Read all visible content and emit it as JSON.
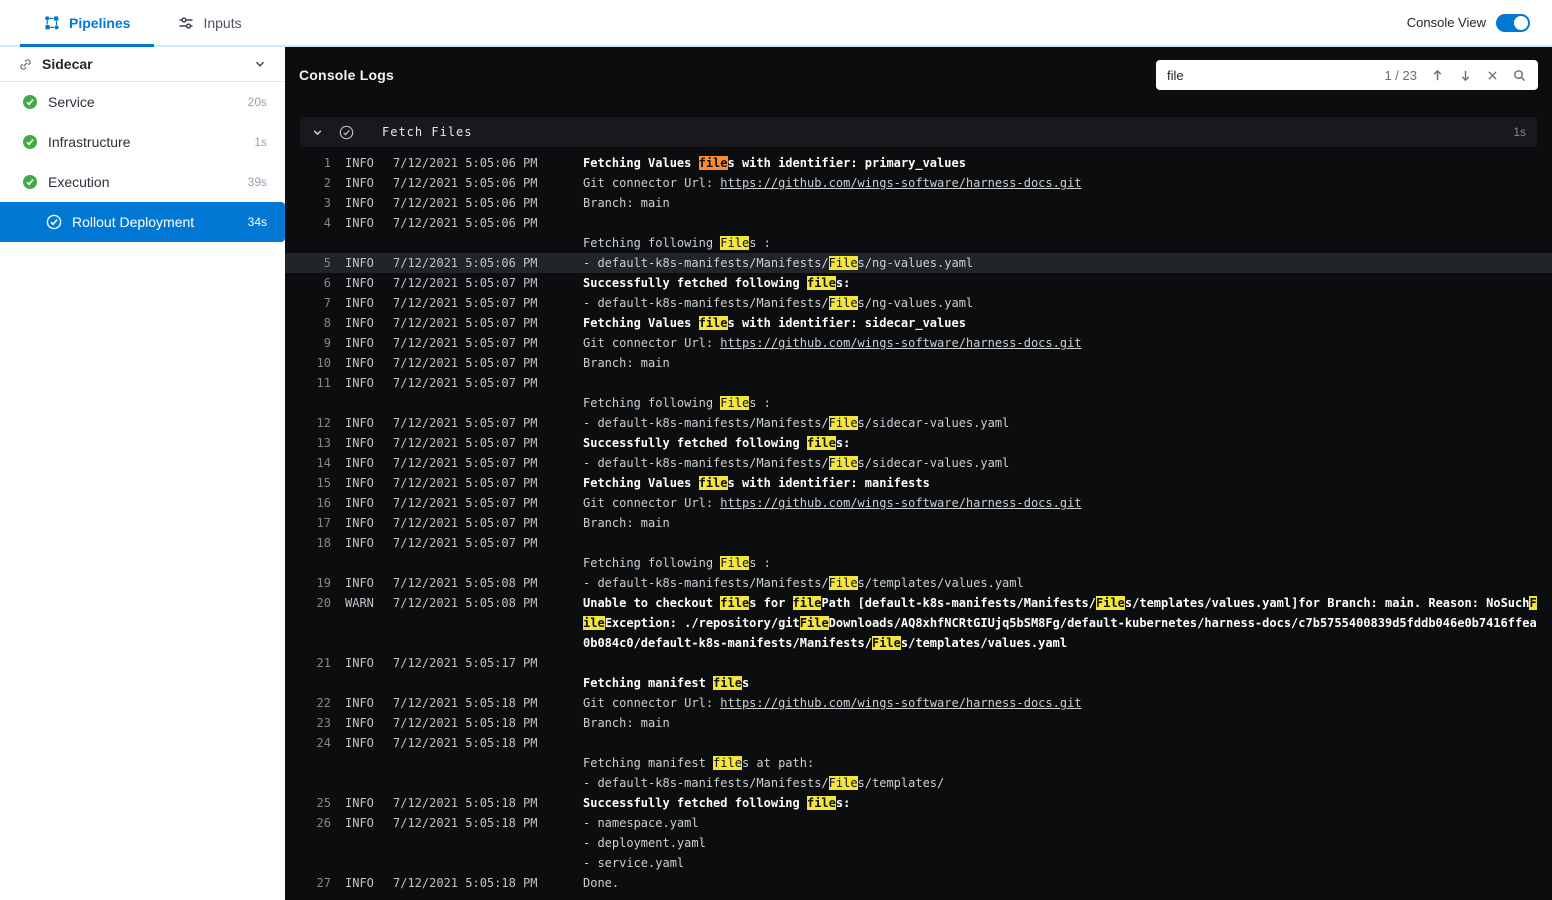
{
  "colors": {
    "accent_blue": "#0278d5",
    "success_green": "#42ab45",
    "highlight_match": "#f4e53c",
    "highlight_current_match": "#ff8c33",
    "console_bg": "#0b0d0e"
  },
  "icons": {
    "pipeline-icon": "flow-nodes",
    "tune-icon": "sliders",
    "link-icon": "chain-link",
    "chevron-down-icon": "v-chevron",
    "status-success-icon": "check-in-circle",
    "arrow-up-icon": "up-arrow",
    "arrow-down-icon": "down-arrow",
    "close-icon": "x-cross",
    "search-icon": "magnifier"
  },
  "topbar": {
    "tabs": [
      {
        "label": "Pipelines",
        "active": true
      },
      {
        "label": "Inputs",
        "active": false
      }
    ],
    "console_view_label": "Console View",
    "console_view_on": true
  },
  "sidebar": {
    "group": {
      "label": "Sidecar"
    },
    "items": [
      {
        "label": "Service",
        "duration": "20s",
        "status": "success",
        "indent": 0,
        "selected": false
      },
      {
        "label": "Infrastructure",
        "duration": "1s",
        "status": "success",
        "indent": 0,
        "selected": false
      },
      {
        "label": "Execution",
        "duration": "39s",
        "status": "success",
        "indent": 0,
        "selected": false
      },
      {
        "label": "Rollout Deployment",
        "duration": "34s",
        "status": "success",
        "indent": 1,
        "selected": true
      }
    ]
  },
  "console": {
    "title": "Console Logs",
    "search": {
      "value": "file",
      "match_count": "1 / 23"
    },
    "section": {
      "title": "Fetch Files",
      "duration": "1s",
      "status": "success"
    }
  },
  "logs": [
    {
      "num": 1,
      "level": "INFO",
      "time": "7/12/2021 5:05:06 PM",
      "bold": true,
      "lines": [
        [
          "Fetching Values ",
          {
            "t": "file",
            "h": "o"
          },
          "s with identifier: primary_values"
        ]
      ]
    },
    {
      "num": 2,
      "level": "INFO",
      "time": "7/12/2021 5:05:06 PM",
      "lines": [
        [
          "Git connector Url: ",
          {
            "t": "https://github.com/wings-software/harness-docs.git",
            "link": true
          }
        ]
      ]
    },
    {
      "num": 3,
      "level": "INFO",
      "time": "7/12/2021 5:05:06 PM",
      "lines": [
        [
          "Branch: main"
        ]
      ]
    },
    {
      "num": 4,
      "level": "INFO",
      "time": "7/12/2021 5:05:06 PM",
      "lines": [
        [],
        [
          "Fetching following ",
          {
            "t": "File",
            "h": "y"
          },
          "s :"
        ]
      ]
    },
    {
      "num": 5,
      "level": "INFO",
      "time": "7/12/2021 5:05:06 PM",
      "selected": true,
      "lines": [
        [
          "- default-k8s-manifests/Manifests/",
          {
            "t": "File",
            "h": "y"
          },
          "s/ng-values.yaml"
        ]
      ]
    },
    {
      "num": 6,
      "level": "INFO",
      "time": "7/12/2021 5:05:07 PM",
      "bold": true,
      "lines": [
        [
          "Successfully fetched following ",
          {
            "t": "file",
            "h": "y"
          },
          "s:"
        ]
      ]
    },
    {
      "num": 7,
      "level": "INFO",
      "time": "7/12/2021 5:05:07 PM",
      "lines": [
        [
          "- default-k8s-manifests/Manifests/",
          {
            "t": "File",
            "h": "y"
          },
          "s/ng-values.yaml"
        ]
      ]
    },
    {
      "num": 8,
      "level": "INFO",
      "time": "7/12/2021 5:05:07 PM",
      "bold": true,
      "lines": [
        [
          "Fetching Values ",
          {
            "t": "file",
            "h": "y"
          },
          "s with identifier: sidecar_values"
        ]
      ]
    },
    {
      "num": 9,
      "level": "INFO",
      "time": "7/12/2021 5:05:07 PM",
      "lines": [
        [
          "Git connector Url: ",
          {
            "t": "https://github.com/wings-software/harness-docs.git",
            "link": true
          }
        ]
      ]
    },
    {
      "num": 10,
      "level": "INFO",
      "time": "7/12/2021 5:05:07 PM",
      "lines": [
        [
          "Branch: main"
        ]
      ]
    },
    {
      "num": 11,
      "level": "INFO",
      "time": "7/12/2021 5:05:07 PM",
      "lines": [
        [],
        [
          "Fetching following ",
          {
            "t": "File",
            "h": "y"
          },
          "s :"
        ]
      ]
    },
    {
      "num": 12,
      "level": "INFO",
      "time": "7/12/2021 5:05:07 PM",
      "lines": [
        [
          "- default-k8s-manifests/Manifests/",
          {
            "t": "File",
            "h": "y"
          },
          "s/sidecar-values.yaml"
        ]
      ]
    },
    {
      "num": 13,
      "level": "INFO",
      "time": "7/12/2021 5:05:07 PM",
      "bold": true,
      "lines": [
        [
          "Successfully fetched following ",
          {
            "t": "file",
            "h": "y"
          },
          "s:"
        ]
      ]
    },
    {
      "num": 14,
      "level": "INFO",
      "time": "7/12/2021 5:05:07 PM",
      "lines": [
        [
          "- default-k8s-manifests/Manifests/",
          {
            "t": "File",
            "h": "y"
          },
          "s/sidecar-values.yaml"
        ]
      ]
    },
    {
      "num": 15,
      "level": "INFO",
      "time": "7/12/2021 5:05:07 PM",
      "bold": true,
      "lines": [
        [
          "Fetching Values ",
          {
            "t": "file",
            "h": "y"
          },
          "s with identifier: manifests"
        ]
      ]
    },
    {
      "num": 16,
      "level": "INFO",
      "time": "7/12/2021 5:05:07 PM",
      "lines": [
        [
          "Git connector Url: ",
          {
            "t": "https://github.com/wings-software/harness-docs.git",
            "link": true
          }
        ]
      ]
    },
    {
      "num": 17,
      "level": "INFO",
      "time": "7/12/2021 5:05:07 PM",
      "lines": [
        [
          "Branch: main"
        ]
      ]
    },
    {
      "num": 18,
      "level": "INFO",
      "time": "7/12/2021 5:05:07 PM",
      "lines": [
        [],
        [
          "Fetching following ",
          {
            "t": "File",
            "h": "y"
          },
          "s :"
        ]
      ]
    },
    {
      "num": 19,
      "level": "INFO",
      "time": "7/12/2021 5:05:08 PM",
      "lines": [
        [
          "- default-k8s-manifests/Manifests/",
          {
            "t": "File",
            "h": "y"
          },
          "s/templates/values.yaml"
        ]
      ]
    },
    {
      "num": 20,
      "level": "WARN",
      "time": "7/12/2021 5:05:08 PM",
      "bold": true,
      "lines": [
        [
          "Unable to checkout ",
          {
            "t": "file",
            "h": "y"
          },
          "s for ",
          {
            "t": "file",
            "h": "y"
          },
          "Path [default-k8s-manifests/Manifests/",
          {
            "t": "File",
            "h": "y"
          },
          "s/templates/values.yaml]for Branch: main. Reason: NoSuch",
          {
            "t": "F",
            "h": "y"
          }
        ],
        [
          {
            "t": "ile",
            "h": "y"
          },
          "Exception: ./repository/git",
          {
            "t": "File",
            "h": "y"
          },
          "Downloads/AQ8xhfNCRtGIUjq5bSM8Fg/default-kubernetes/harness-docs/c7b5755400839d5fddb046e0b7416ffea"
        ],
        [
          "0b084c0/default-k8s-manifests/Manifests/",
          {
            "t": "File",
            "h": "y"
          },
          "s/templates/values.yaml"
        ]
      ]
    },
    {
      "num": 21,
      "level": "INFO",
      "time": "7/12/2021 5:05:17 PM",
      "bold": true,
      "lines": [
        [],
        [
          "Fetching manifest ",
          {
            "t": "file",
            "h": "y"
          },
          "s"
        ]
      ]
    },
    {
      "num": 22,
      "level": "INFO",
      "time": "7/12/2021 5:05:18 PM",
      "lines": [
        [
          "Git connector Url: ",
          {
            "t": "https://github.com/wings-software/harness-docs.git",
            "link": true
          }
        ]
      ]
    },
    {
      "num": 23,
      "level": "INFO",
      "time": "7/12/2021 5:05:18 PM",
      "lines": [
        [
          "Branch: main"
        ]
      ]
    },
    {
      "num": 24,
      "level": "INFO",
      "time": "7/12/2021 5:05:18 PM",
      "lines": [
        [],
        [
          "Fetching manifest ",
          {
            "t": "file",
            "h": "y"
          },
          "s at path:"
        ],
        [
          "- default-k8s-manifests/Manifests/",
          {
            "t": "File",
            "h": "y"
          },
          "s/templates/"
        ]
      ]
    },
    {
      "num": 25,
      "level": "INFO",
      "time": "7/12/2021 5:05:18 PM",
      "bold": true,
      "lines": [
        [
          "Successfully fetched following ",
          {
            "t": "file",
            "h": "y"
          },
          "s:"
        ]
      ]
    },
    {
      "num": 26,
      "level": "INFO",
      "time": "7/12/2021 5:05:18 PM",
      "lines": [
        [
          "- namespace.yaml"
        ],
        [
          "- deployment.yaml"
        ],
        [
          "- service.yaml"
        ]
      ]
    },
    {
      "num": 27,
      "level": "INFO",
      "time": "7/12/2021 5:05:18 PM",
      "lines": [
        [
          "Done."
        ]
      ]
    }
  ]
}
